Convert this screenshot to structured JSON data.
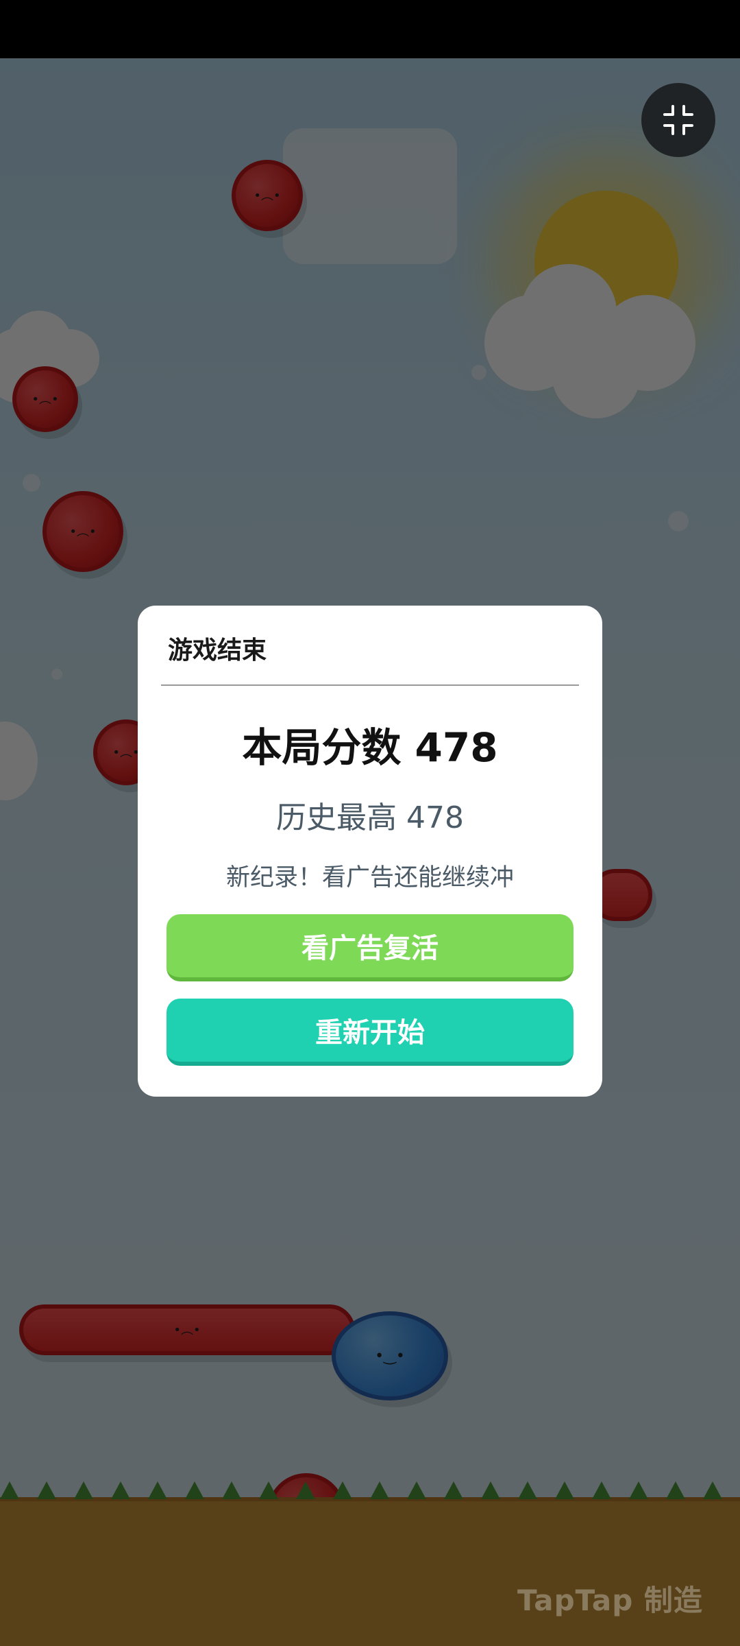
{
  "game_over_dialog": {
    "title": "游戏结束",
    "score_text": "本局分数 478",
    "best_text": "历史最高 478",
    "hint_text": "新纪录！看广告还能继续冲",
    "revive_button_label": "看广告复活",
    "restart_button_label": "重新开始"
  },
  "score": 478,
  "best_score": 478,
  "watermark": "TapTap 制造",
  "fullscreen_icon": "exit-fullscreen-icon",
  "colors": {
    "revive_button": "#7ed956",
    "restart_button": "#1fd1b1",
    "dialog_background": "#ffffff",
    "enemy": "#e02525",
    "player": "#3a8fe6",
    "ground": "#c9943a"
  }
}
